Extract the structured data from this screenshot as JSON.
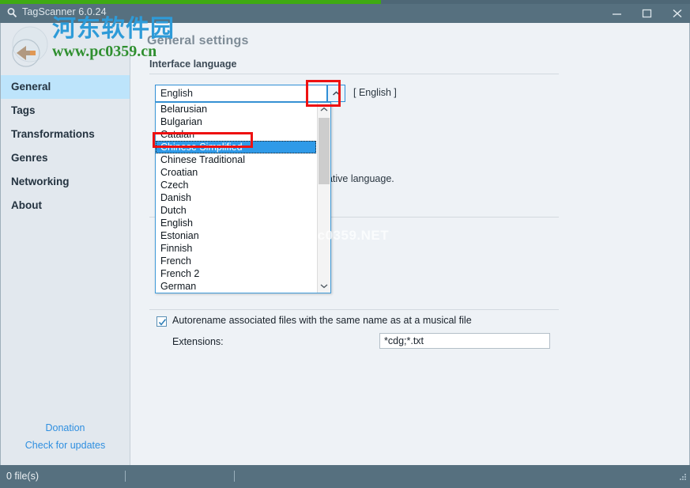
{
  "window": {
    "title": "TagScanner 6.0.24",
    "icon": "magnifier-icon",
    "minimize_label": "Minimize",
    "maximize_label": "Maximize",
    "close_label": "Close"
  },
  "watermark": {
    "chinese": "河东软件园",
    "url": "www.pc0359.cn",
    "faint": "www.pc0359.NET"
  },
  "sidebar": {
    "items": [
      {
        "label": "General",
        "active": true
      },
      {
        "label": "Tags",
        "active": false
      },
      {
        "label": "Transformations",
        "active": false
      },
      {
        "label": "Genres",
        "active": false
      },
      {
        "label": "Networking",
        "active": false
      },
      {
        "label": "About",
        "active": false
      }
    ],
    "links": [
      {
        "label": "Donation"
      },
      {
        "label": "Check for updates"
      }
    ]
  },
  "content": {
    "page_title": "General settings",
    "group_label": "Interface language",
    "hint_text": "You can help with translation for your native language.",
    "combo": {
      "value": "English",
      "side_text": "[ English ]",
      "arrow_icon": "chevron-up-icon"
    },
    "dropdown": {
      "selected": "Chinese Simplified",
      "items": [
        "Belarusian",
        "Bulgarian",
        "Catalan",
        "Chinese Simplified",
        "Chinese Traditional",
        "Croatian",
        "Czech",
        "Danish",
        "Dutch",
        "English",
        "Estonian",
        "Finnish",
        "French",
        "French 2",
        "German"
      ]
    },
    "checkbox": {
      "label": "Autorename associated files with the same name as at a musical file",
      "checked": true
    },
    "extensions": {
      "label": "Extensions:",
      "value": "*cdg;*.txt"
    }
  },
  "statusbar": {
    "files_text": "0 file(s)"
  },
  "colors": {
    "titlebar": "#56707f",
    "accent_blue": "#2f9ae8",
    "sidebar_active": "#bde4fb",
    "link_blue": "#2f8fe0",
    "annotation_red": "#ee1111",
    "green_strip": "#3faa12"
  }
}
